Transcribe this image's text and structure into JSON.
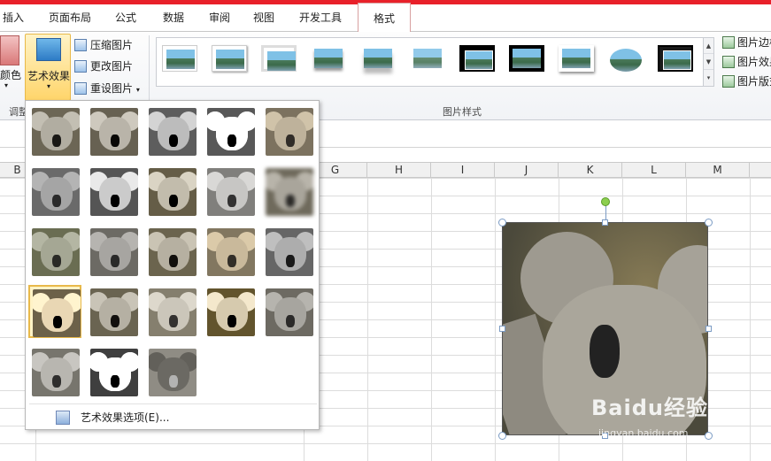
{
  "tabs": [
    "插入",
    "页面布局",
    "公式",
    "数据",
    "审阅",
    "视图",
    "开发工具",
    "格式"
  ],
  "ribbon": {
    "left_partial_label": "颜色",
    "adjust_group_partial": "调整",
    "art_effects_label": "艺术效果",
    "compress_label": "压缩图片",
    "change_label": "更改图片",
    "reset_label": "重设图片",
    "picture_styles_group": "图片样式",
    "border_label": "图片边框",
    "effects_label": "图片效果",
    "layout_label": "图片版式"
  },
  "columns": [
    "B",
    "G",
    "H",
    "I",
    "J",
    "K",
    "L",
    "M"
  ],
  "art_menu": {
    "selected_index": 15,
    "options_label": "艺术效果选项(E)..."
  },
  "watermark": {
    "brand": "Baidu经验",
    "url": "jingyan.baidu.com"
  },
  "colors": {
    "accent_bar": "#e8202a",
    "selected_button": "#ffd56b",
    "grid_line": "#dcdcdc"
  }
}
